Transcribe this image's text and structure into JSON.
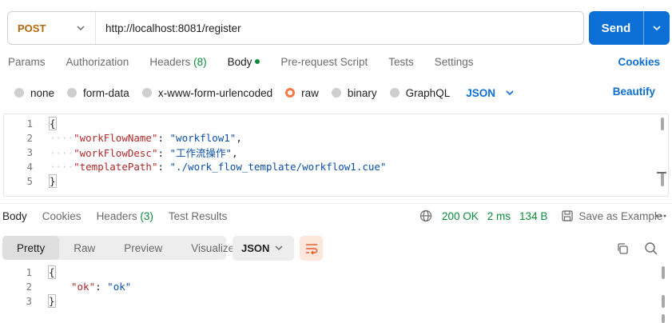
{
  "request": {
    "method": "POST",
    "url": "http://localhost:8081/register",
    "send_label": "Send"
  },
  "request_tabs": {
    "params": "Params",
    "authorization": "Authorization",
    "headers": "Headers",
    "headers_count": "(8)",
    "body": "Body",
    "prerequest": "Pre-request Script",
    "tests": "Tests",
    "settings": "Settings",
    "cookies": "Cookies"
  },
  "body_types": {
    "none": "none",
    "form_data": "form-data",
    "urlencoded": "x-www-form-urlencoded",
    "raw": "raw",
    "binary": "binary",
    "graphql": "GraphQL",
    "format": "JSON",
    "beautify": "Beautify"
  },
  "request_body": {
    "line_numbers": [
      "1",
      "2",
      "3",
      "4",
      "5"
    ],
    "open_brace": "{",
    "close_brace": "}",
    "fields": [
      {
        "key": "\"workFlowName\"",
        "value": "\"workflow1\"",
        "comma": ","
      },
      {
        "key": "\"workFlowDesc\"",
        "value": "\"工作流操作\"",
        "comma": ","
      },
      {
        "key": "\"templatePath\"",
        "value": "\"./work_flow_template/workflow1.cue\"",
        "comma": ""
      }
    ],
    "indent_dots": "····"
  },
  "response_tabs": {
    "body": "Body",
    "cookies": "Cookies",
    "headers": "Headers",
    "headers_count": "(3)",
    "test_results": "Test Results"
  },
  "response_status": {
    "status": "200 OK",
    "time": "2 ms",
    "size": "134 B",
    "save": "Save as Example"
  },
  "response_view": {
    "pretty": "Pretty",
    "raw": "Raw",
    "preview": "Preview",
    "visualize": "Visualize",
    "format": "JSON"
  },
  "response_body": {
    "line_numbers": [
      "1",
      "2",
      "3"
    ],
    "open_brace": "{",
    "close_brace": "}",
    "key": "\"ok\"",
    "value": "\"ok\""
  },
  "colors": {
    "accent": "#0b6fd6",
    "method": "#b0690a",
    "success": "#0a8a3a",
    "json_key": "#b0292b",
    "json_string": "#0b4fa8"
  }
}
